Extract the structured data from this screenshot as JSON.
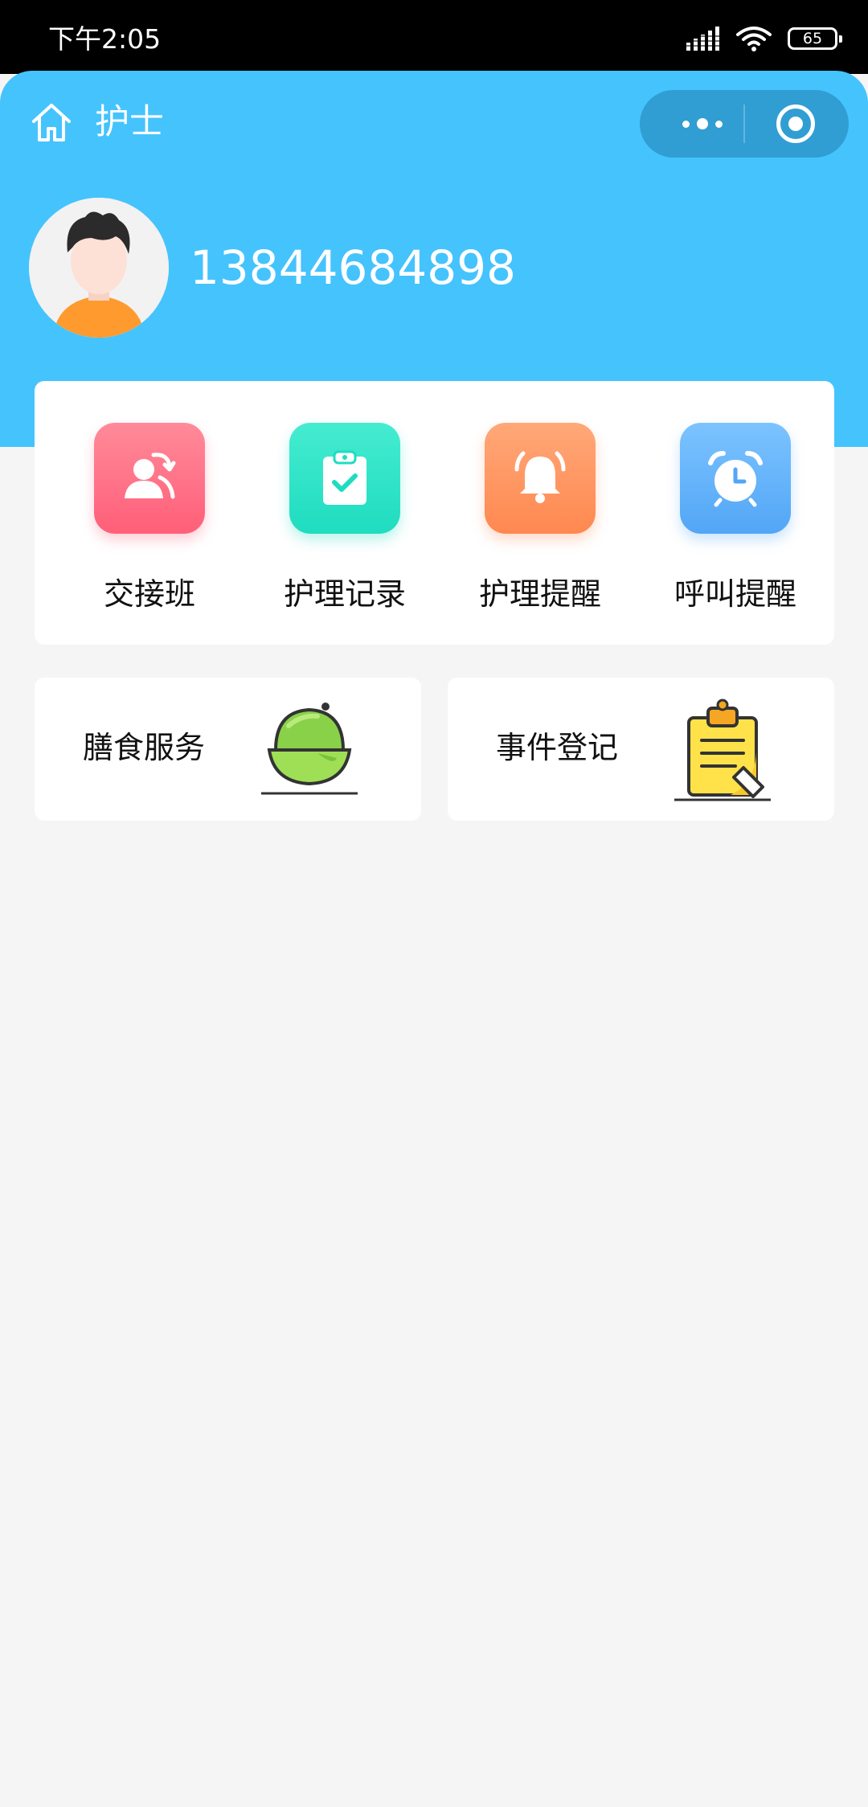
{
  "status_bar": {
    "time": "下午2:05",
    "battery_level": "65"
  },
  "nav": {
    "title": "护士"
  },
  "profile": {
    "phone": "13844684898"
  },
  "menu": [
    {
      "label": "交接班",
      "icon": "handover-icon",
      "color": "#ff6b81"
    },
    {
      "label": "护理记录",
      "icon": "clipboard-check-icon",
      "color": "#2ee0c0"
    },
    {
      "label": "护理提醒",
      "icon": "bell-icon",
      "color": "#ff9460"
    },
    {
      "label": "呼叫提醒",
      "icon": "alarm-clock-icon",
      "color": "#5fb0ff"
    }
  ],
  "services": [
    {
      "label": "膳食服务",
      "icon": "food-bowl-icon"
    },
    {
      "label": "事件登记",
      "icon": "clipboard-pen-icon"
    }
  ],
  "colors": {
    "header": "#45c3fd",
    "page_background": "#f5f5f5"
  }
}
